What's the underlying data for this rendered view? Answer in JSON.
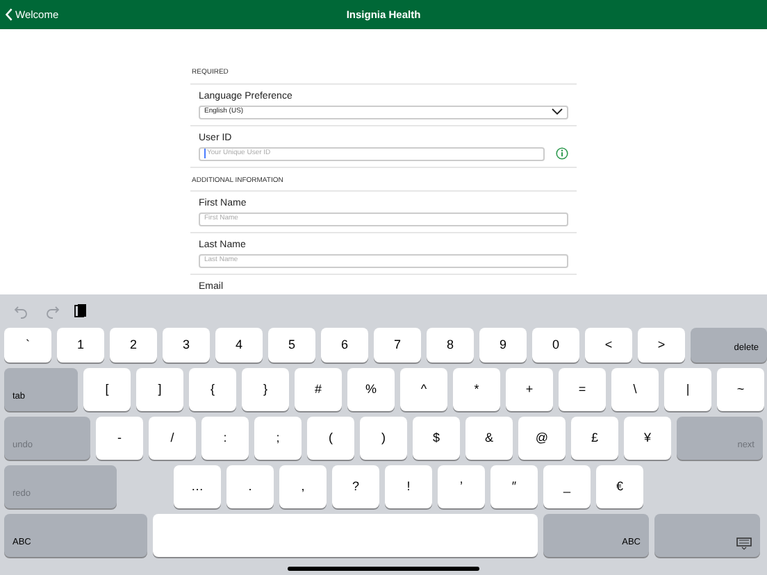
{
  "nav_bar": {
    "back_label": "Welcome",
    "title": "Insignia Health"
  },
  "sections": [
    {
      "header": "REQUIRED",
      "fields": [
        {
          "label": "Language Preference",
          "kind": "select",
          "value": "English (US)"
        },
        {
          "label": "User ID",
          "kind": "text",
          "placeholder": "Your Unique User ID",
          "focused": true,
          "info": true
        }
      ]
    },
    {
      "header": "ADDITIONAL INFORMATION",
      "fields": [
        {
          "label": "First Name",
          "kind": "text",
          "placeholder": "First Name",
          "focused": false
        },
        {
          "label": "Last Name",
          "kind": "text",
          "placeholder": "Last Name",
          "focused": false
        },
        {
          "label": "Email",
          "kind": "label_only"
        }
      ]
    }
  ],
  "keyboard": {
    "toolbar": [
      {
        "kind": "undo",
        "disabled": true
      },
      {
        "kind": "redo",
        "disabled": true
      },
      {
        "kind": "paste",
        "disabled": false
      }
    ],
    "rows": [
      {
        "keys": [
          {
            "label": "`",
            "kind": "char"
          },
          {
            "label": "1",
            "kind": "char"
          },
          {
            "label": "2",
            "kind": "char"
          },
          {
            "label": "3",
            "kind": "char"
          },
          {
            "label": "4",
            "kind": "char"
          },
          {
            "label": "5",
            "kind": "char"
          },
          {
            "label": "6",
            "kind": "char"
          },
          {
            "label": "7",
            "kind": "char"
          },
          {
            "label": "8",
            "kind": "char"
          },
          {
            "label": "9",
            "kind": "char"
          },
          {
            "label": "0",
            "kind": "char"
          },
          {
            "label": "<",
            "kind": "char"
          },
          {
            "label": ">",
            "kind": "char"
          },
          {
            "label": "delete",
            "kind": "right",
            "disabled": false
          }
        ]
      },
      {
        "keys": [
          {
            "label": "tab",
            "kind": "left",
            "disabled": false
          },
          {
            "label": "[",
            "kind": "char"
          },
          {
            "label": "]",
            "kind": "char"
          },
          {
            "label": "{",
            "kind": "char"
          },
          {
            "label": "}",
            "kind": "char"
          },
          {
            "label": "#",
            "kind": "char"
          },
          {
            "label": "%",
            "kind": "char"
          },
          {
            "label": "^",
            "kind": "char"
          },
          {
            "label": "*",
            "kind": "char"
          },
          {
            "label": "+",
            "kind": "char"
          },
          {
            "label": "=",
            "kind": "char"
          },
          {
            "label": "\\",
            "kind": "char"
          },
          {
            "label": "|",
            "kind": "char"
          },
          {
            "label": "~",
            "kind": "char"
          }
        ]
      },
      {
        "keys": [
          {
            "label": "undo",
            "kind": "left",
            "disabled": true
          },
          {
            "label": "-",
            "kind": "char"
          },
          {
            "label": "/",
            "kind": "char"
          },
          {
            "label": ":",
            "kind": "char"
          },
          {
            "label": ";",
            "kind": "char"
          },
          {
            "label": "(",
            "kind": "char"
          },
          {
            "label": ")",
            "kind": "char"
          },
          {
            "label": "$",
            "kind": "char"
          },
          {
            "label": "&",
            "kind": "char"
          },
          {
            "label": "@",
            "kind": "char"
          },
          {
            "label": "£",
            "kind": "char"
          },
          {
            "label": "¥",
            "kind": "char"
          },
          {
            "label": "next",
            "kind": "right",
            "disabled": true
          }
        ]
      },
      {
        "keys": [
          {
            "label": "redo",
            "kind": "left",
            "disabled": true
          },
          {
            "kind": "gap"
          },
          {
            "label": "…",
            "kind": "char"
          },
          {
            "label": ".",
            "kind": "char"
          },
          {
            "label": ",",
            "kind": "char"
          },
          {
            "label": "?",
            "kind": "char"
          },
          {
            "label": "!",
            "kind": "char"
          },
          {
            "label": "’",
            "kind": "char"
          },
          {
            "label": "″",
            "kind": "char"
          },
          {
            "label": "_",
            "kind": "char"
          },
          {
            "label": "€",
            "kind": "char"
          }
        ]
      },
      {
        "keys": [
          {
            "label": "ABC",
            "kind": "left",
            "disabled": false
          },
          {
            "kind": "space"
          },
          {
            "label": "ABC",
            "kind": "right",
            "disabled": false
          },
          {
            "kind": "dismiss"
          }
        ]
      }
    ]
  }
}
